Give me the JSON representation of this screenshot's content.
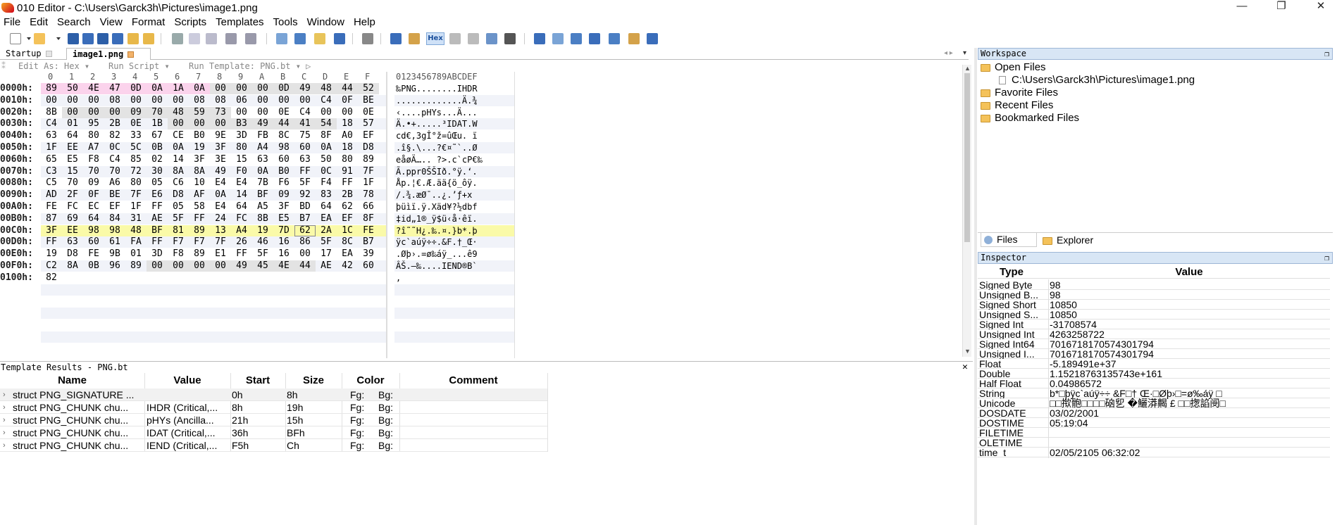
{
  "window": {
    "title": "010 Editor - C:\\Users\\Garck3h\\Pictures\\image1.png",
    "min": "—",
    "max": "❐",
    "close": "✕"
  },
  "menu": [
    "File",
    "Edit",
    "Search",
    "View",
    "Format",
    "Scripts",
    "Templates",
    "Tools",
    "Window",
    "Help"
  ],
  "toolbar": {
    "hex_label": "Hex"
  },
  "tabs": [
    {
      "label": "Startup"
    },
    {
      "label": "image1.png"
    }
  ],
  "subtoolbar": {
    "edit_as": "Edit As: Hex ▾",
    "run_script": "Run Script ▾",
    "run_template": "Run Template: PNG.bt ▾ ▷"
  },
  "hex": {
    "col_headers": [
      "0",
      "1",
      "2",
      "3",
      "4",
      "5",
      "6",
      "7",
      "8",
      "9",
      "A",
      "B",
      "C",
      "D",
      "E",
      "F"
    ],
    "ascii_header": "0123456789ABCDEF",
    "rows": [
      {
        "addr": "0000h:",
        "bytes": [
          "89",
          "50",
          "4E",
          "47",
          "0D",
          "0A",
          "1A",
          "0A",
          "00",
          "00",
          "00",
          "0D",
          "49",
          "48",
          "44",
          "52"
        ],
        "ascii": "‰PNG........IHDR"
      },
      {
        "addr": "0010h:",
        "bytes": [
          "00",
          "00",
          "00",
          "08",
          "00",
          "00",
          "00",
          "08",
          "08",
          "06",
          "00",
          "00",
          "00",
          "C4",
          "0F",
          "BE"
        ],
        "ascii": ".............Ä.¾"
      },
      {
        "addr": "0020h:",
        "bytes": [
          "8B",
          "00",
          "00",
          "00",
          "09",
          "70",
          "48",
          "59",
          "73",
          "00",
          "00",
          "0E",
          "C4",
          "00",
          "00",
          "0E"
        ],
        "ascii": "‹....pHYs...Ä..."
      },
      {
        "addr": "0030h:",
        "bytes": [
          "C4",
          "01",
          "95",
          "2B",
          "0E",
          "1B",
          "00",
          "00",
          "00",
          "B3",
          "49",
          "44",
          "41",
          "54",
          "18",
          "57"
        ],
        "ascii": "Ä.•+.....³IDAT.W"
      },
      {
        "addr": "0040h:",
        "bytes": [
          "63",
          "64",
          "80",
          "82",
          "33",
          "67",
          "CE",
          "B0",
          "9E",
          "3D",
          "FB",
          "8C",
          "75",
          "8F",
          "A0",
          "EF"
        ],
        "ascii": "cd€‚3gÎ°ž=ûŒu. ï"
      },
      {
        "addr": "0050h:",
        "bytes": [
          "1F",
          "EE",
          "A7",
          "0C",
          "5C",
          "0B",
          "0A",
          "19",
          "3F",
          "80",
          "A4",
          "98",
          "60",
          "0A",
          "18",
          "D8"
        ],
        "ascii": ".î§.\\...?€¤˜`..Ø"
      },
      {
        "addr": "0060h:",
        "bytes": [
          "65",
          "E5",
          "F8",
          "C4",
          "85",
          "02",
          "14",
          "3F",
          "3E",
          "15",
          "63",
          "60",
          "63",
          "50",
          "80",
          "89"
        ],
        "ascii": "eåøÄ….. ?>.c`cP€‰"
      },
      {
        "addr": "0070h:",
        "bytes": [
          "C3",
          "15",
          "70",
          "70",
          "72",
          "30",
          "8A",
          "8A",
          "49",
          "F0",
          "0A",
          "B0",
          "FF",
          "0C",
          "91",
          "7F"
        ],
        "ascii": "Ã.ppr0ŠŠIð.°ÿ.‘."
      },
      {
        "addr": "0080h:",
        "bytes": [
          "C5",
          "70",
          "09",
          "A6",
          "80",
          "05",
          "C6",
          "10",
          "E4",
          "E4",
          "7B",
          "F6",
          "5F",
          "F4",
          "FF",
          "1F"
        ],
        "ascii": "Åp.¦€.Æ.ää{ö_ôÿ."
      },
      {
        "addr": "0090h:",
        "bytes": [
          "AD",
          "2F",
          "0F",
          "BE",
          "7F",
          "E6",
          "D8",
          "AF",
          "0A",
          "14",
          "BF",
          "09",
          "92",
          "83",
          "2B",
          "78"
        ],
        "ascii": "­/.¾.æØ¯..¿.’ƒ+x"
      },
      {
        "addr": "00A0h:",
        "bytes": [
          "FE",
          "FC",
          "EC",
          "EF",
          "1F",
          "FF",
          "05",
          "58",
          "E4",
          "64",
          "A5",
          "3F",
          "BD",
          "64",
          "62",
          "66"
        ],
        "ascii": "þüìï.ÿ.Xäd¥?½dbf"
      },
      {
        "addr": "00B0h:",
        "bytes": [
          "87",
          "69",
          "64",
          "84",
          "31",
          "AE",
          "5F",
          "FF",
          "24",
          "FC",
          "8B",
          "E5",
          "B7",
          "EA",
          "EF",
          "8F"
        ],
        "ascii": "‡id„1®_ÿ$ü‹å·êï."
      },
      {
        "addr": "00C0h:",
        "bytes": [
          "3F",
          "EE",
          "98",
          "98",
          "48",
          "BF",
          "81",
          "89",
          "13",
          "A4",
          "19",
          "7D",
          "62",
          "2A",
          "1C",
          "FE"
        ],
        "ascii": "?î˜˜H¿.‰.¤.}b*.þ"
      },
      {
        "addr": "00D0h:",
        "bytes": [
          "FF",
          "63",
          "60",
          "61",
          "FA",
          "FF",
          "F7",
          "F7",
          "7F",
          "26",
          "46",
          "16",
          "86",
          "5F",
          "8C",
          "B7"
        ],
        "ascii": "ÿc`aúÿ÷÷.&F.†_Œ·"
      },
      {
        "addr": "00E0h:",
        "bytes": [
          "19",
          "D8",
          "FE",
          "9B",
          "01",
          "3D",
          "F8",
          "89",
          "E1",
          "FF",
          "5F",
          "16",
          "00",
          "17",
          "EA",
          "39"
        ],
        "ascii": ".Øþ›.=ø‰áÿ_...ê9"
      },
      {
        "addr": "00F0h:",
        "bytes": [
          "C2",
          "8A",
          "0B",
          "96",
          "89",
          "00",
          "00",
          "00",
          "00",
          "49",
          "45",
          "4E",
          "44",
          "AE",
          "42",
          "60"
        ],
        "ascii": "ÂŠ.–‰....IEND®B`"
      },
      {
        "addr": "0100h:",
        "bytes": [
          "82"
        ],
        "ascii": "‚"
      }
    ]
  },
  "template_results": {
    "header": "Template Results - PNG.bt",
    "columns": [
      "Name",
      "Value",
      "Start",
      "Size",
      "Color",
      "Comment"
    ],
    "rows": [
      {
        "name": "struct PNG_SIGNATURE ...",
        "value": "",
        "start": "0h",
        "size": "8h",
        "fg": "Fg:",
        "bg": "Bg:"
      },
      {
        "name": "struct PNG_CHUNK chu...",
        "value": "IHDR  (Critical,...",
        "start": "8h",
        "size": "19h",
        "fg": "Fg:",
        "bg": "Bg:"
      },
      {
        "name": "struct PNG_CHUNK chu...",
        "value": "pHYs  (Ancilla...",
        "start": "21h",
        "size": "15h",
        "fg": "Fg:",
        "bg": "Bg:"
      },
      {
        "name": "struct PNG_CHUNK chu...",
        "value": "IDAT  (Critical,...",
        "start": "36h",
        "size": "BFh",
        "fg": "Fg:",
        "bg": "Bg:"
      },
      {
        "name": "struct PNG_CHUNK chu...",
        "value": "IEND  (Critical,...",
        "start": "F5h",
        "size": "Ch",
        "fg": "Fg:",
        "bg": "Bg:"
      }
    ]
  },
  "workspace": {
    "header": "Workspace",
    "items": [
      {
        "label": "Open Files"
      },
      {
        "label": "C:\\Users\\Garck3h\\Pictures\\image1.png"
      },
      {
        "label": "Favorite Files"
      },
      {
        "label": "Recent Files"
      },
      {
        "label": "Bookmarked Files"
      }
    ],
    "tab_files": "Files",
    "tab_explorer": "Explorer"
  },
  "inspector": {
    "header": "Inspector",
    "col_type": "Type",
    "col_value": "Value",
    "rows": [
      {
        "type": "Signed Byte",
        "value": "98"
      },
      {
        "type": "Unsigned B...",
        "value": "98"
      },
      {
        "type": "Signed Short",
        "value": "10850"
      },
      {
        "type": "Unsigned S...",
        "value": "10850"
      },
      {
        "type": "Signed Int",
        "value": "-31708574"
      },
      {
        "type": "Unsigned Int",
        "value": "4263258722"
      },
      {
        "type": "Signed Int64",
        "value": "7016718170574301794"
      },
      {
        "type": "Unsigned I...",
        "value": "7016718170574301794"
      },
      {
        "type": "Float",
        "value": "-5.189491e+37"
      },
      {
        "type": "Double",
        "value": "1.15218763135743e+161"
      },
      {
        "type": "Half Float",
        "value": "0.04986572"
      },
      {
        "type": "String",
        "value": "b*□þÿc`aúÿ÷÷ &F□† Œ·□Øþ›□=ø‰áÿ □"
      },
      {
        "type": "Unicode",
        "value": "□□揿骲□□□□硇乮 �鱺漭齃 £ □□揔諂阌□"
      },
      {
        "type": "DOSDATE",
        "value": "03/02/2001"
      },
      {
        "type": "DOSTIME",
        "value": "05:19:04"
      },
      {
        "type": "FILETIME",
        "value": ""
      },
      {
        "type": "OLETIME",
        "value": ""
      },
      {
        "type": "time_t",
        "value": "02/05/2105 06:32:02"
      }
    ]
  }
}
